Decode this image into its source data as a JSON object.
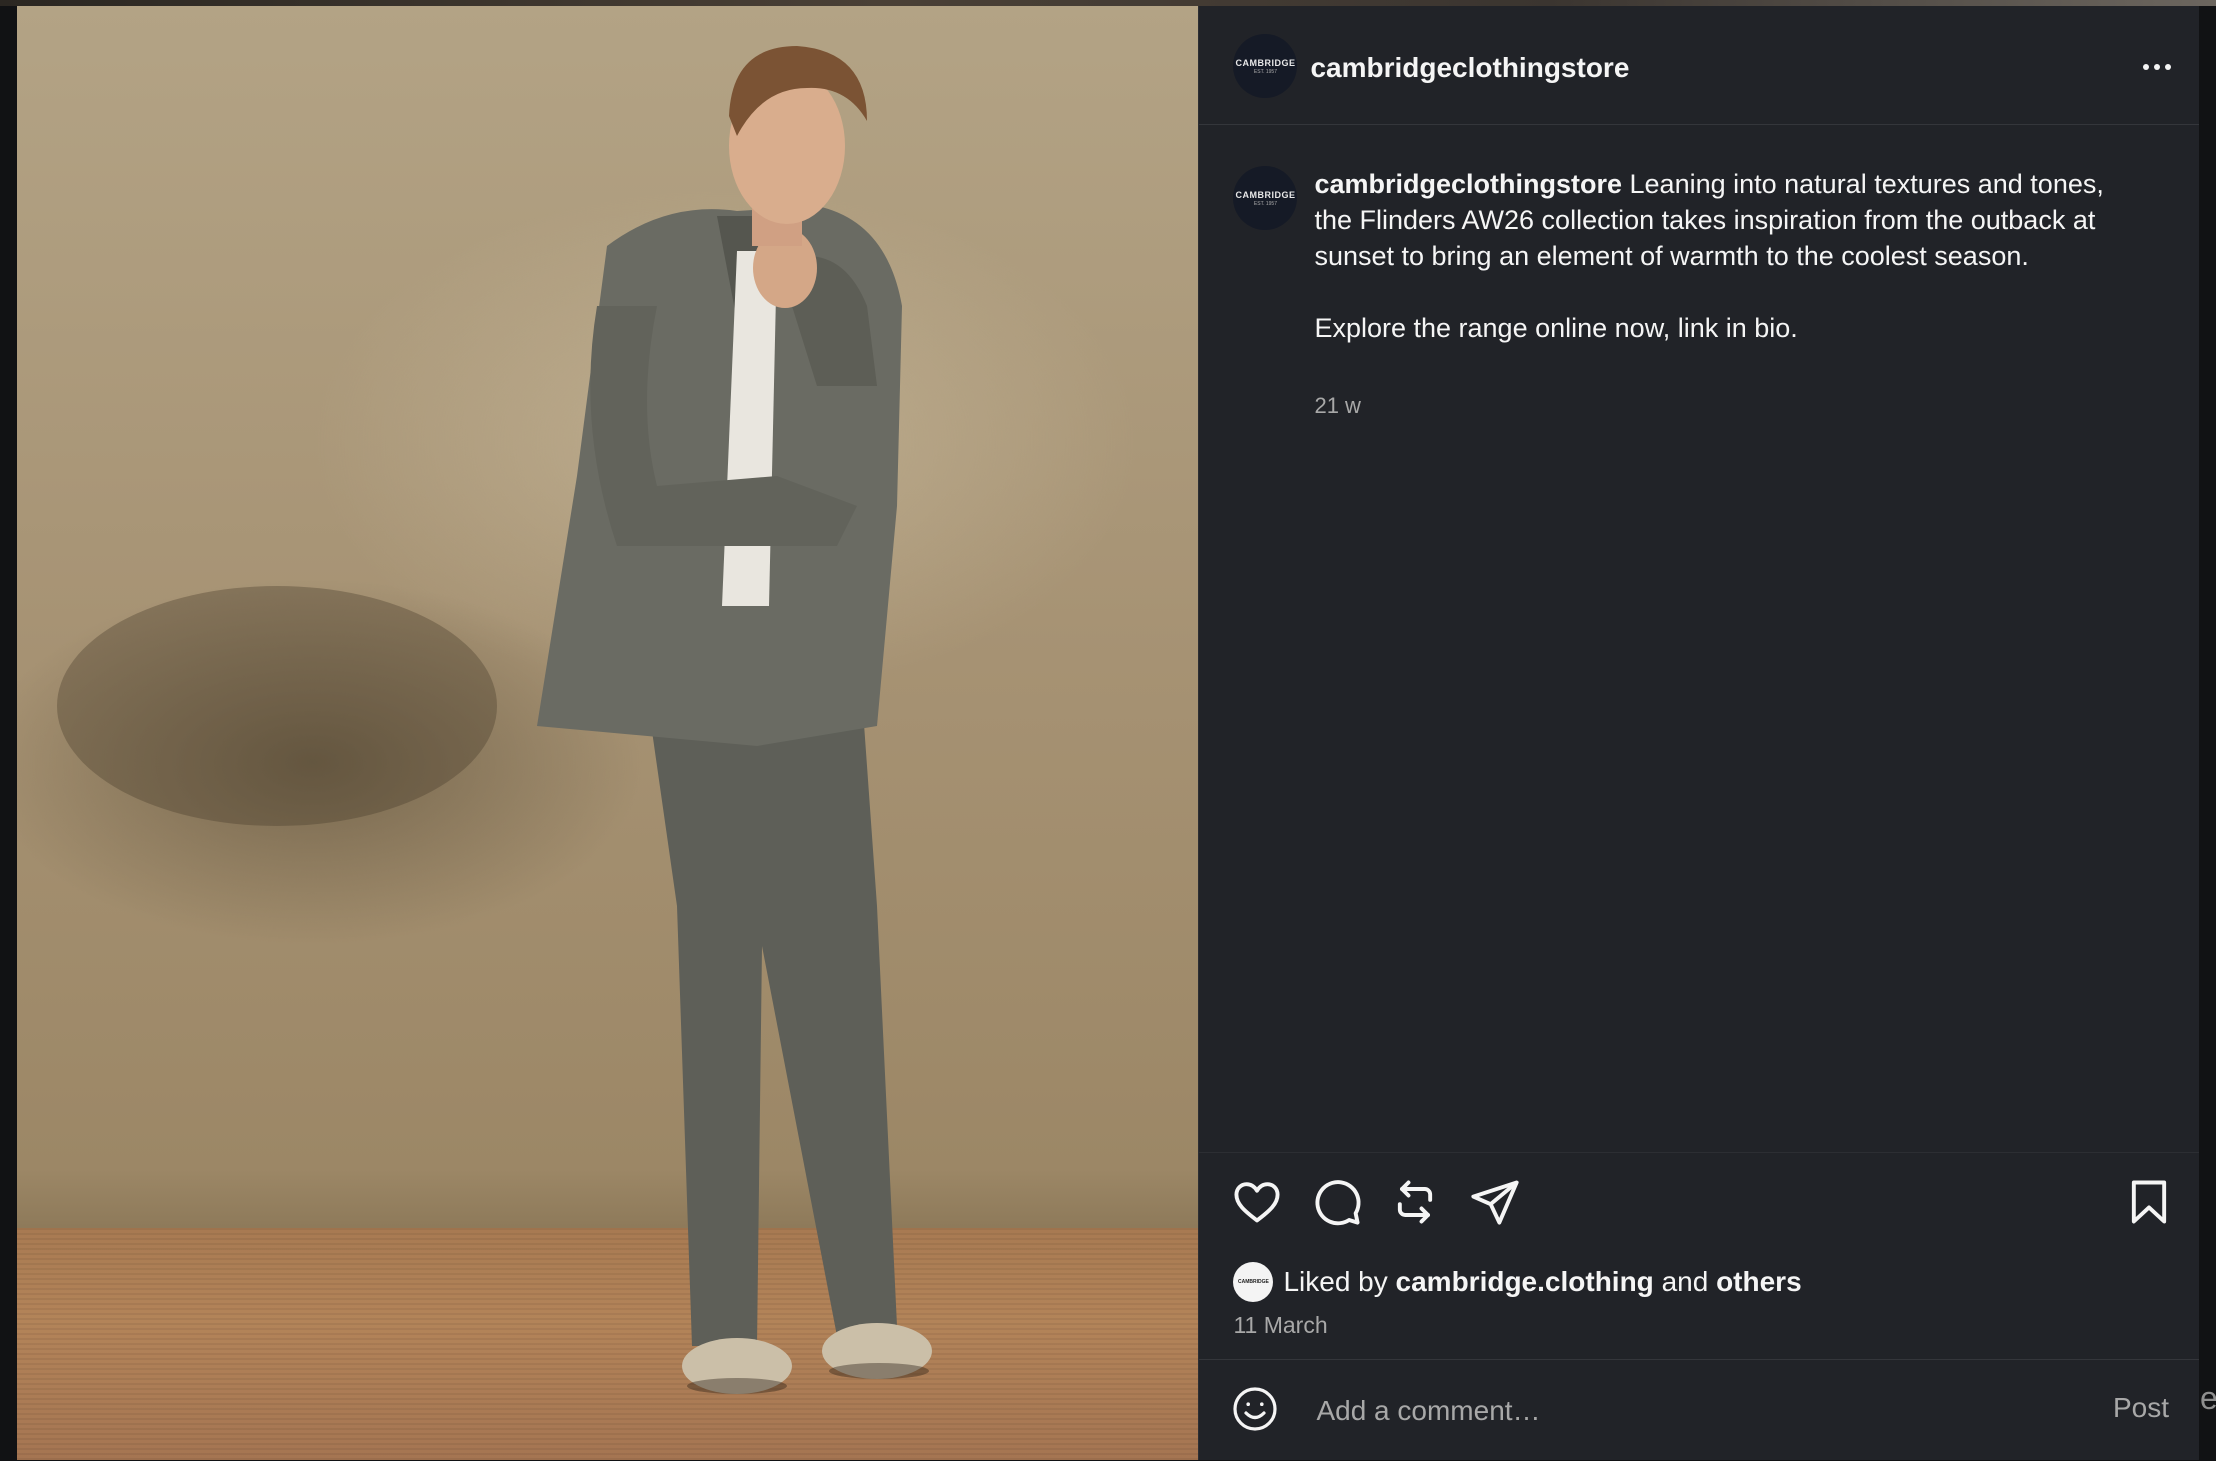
{
  "post": {
    "username": "cambridgeclothingstore",
    "avatar_brand": "CAMBRIDGE",
    "avatar_est": "EST. 1957",
    "more_icon": "more-horizontal-icon",
    "caption_user": "cambridgeclothingstore",
    "caption_text": "Leaning into natural textures and tones, the Flinders AW26 collection takes inspiration from the outback at sunset to bring an element of warmth to the coolest season.",
    "caption_text_2": "Explore the range online now, link in bio.",
    "time_ago": "21 w"
  },
  "actions": {
    "like_icon": "heart-icon",
    "comment_icon": "comment-icon",
    "repost_icon": "repost-icon",
    "share_icon": "send-icon",
    "save_icon": "bookmark-icon"
  },
  "likes": {
    "prefix": "Liked by",
    "liker": "cambridge.clothing",
    "joiner": "and",
    "others": "others",
    "mini_avatar_text": "CAMBRIDGE"
  },
  "date": "11 March",
  "comment": {
    "emoji_icon": "smiley-icon",
    "placeholder": "Add a comment…",
    "post_label": "Post"
  },
  "edge_text": "e",
  "colors": {
    "panel_bg": "#212328",
    "text_primary": "#f5f5f5",
    "text_secondary": "#a8a8a8"
  }
}
